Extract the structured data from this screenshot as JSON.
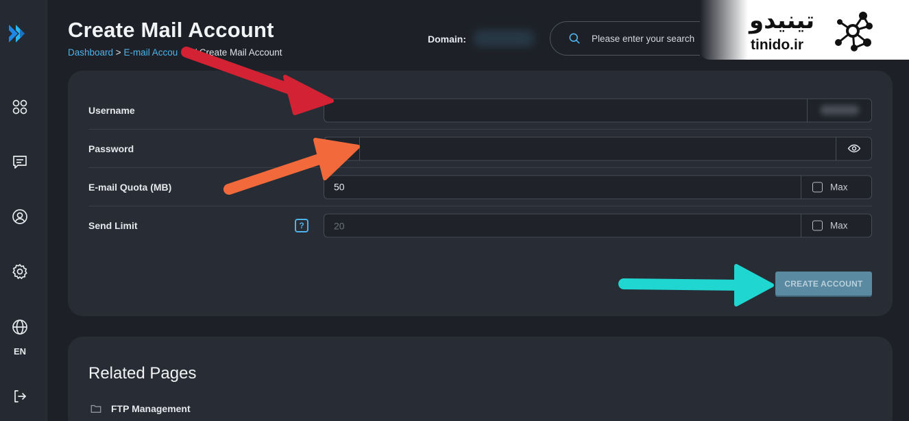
{
  "sidebar": {
    "language": "EN",
    "items": [
      {
        "icon": "grid-icon"
      },
      {
        "icon": "message-icon"
      },
      {
        "icon": "user-circle-icon"
      },
      {
        "icon": "settings-icon"
      },
      {
        "icon": "globe-icon"
      },
      {
        "icon": "logout-icon"
      }
    ]
  },
  "header": {
    "title": "Create Mail Account",
    "breadcrumb": {
      "dashboard": "Dashboard",
      "separator1": " > ",
      "email_accounts": "E-mail Accou",
      "current": "/ Create Mail Account"
    },
    "domain_label": "Domain:",
    "search_placeholder": "Please enter your search"
  },
  "watermark": {
    "persian_text": "تینیدو",
    "site": "tinido.ir"
  },
  "form": {
    "username": {
      "label": "Username",
      "value": ""
    },
    "password": {
      "label": "Password",
      "value": ""
    },
    "quota": {
      "label": "E-mail Quota (MB)",
      "value": "50",
      "max_label": "Max"
    },
    "send_limit": {
      "label": "Send Limit",
      "placeholder": "20",
      "help": "?",
      "max_label": "Max"
    },
    "submit_label": "CREATE ACCOUNT"
  },
  "related": {
    "title": "Related Pages",
    "items": [
      {
        "label": "FTP Management"
      }
    ]
  },
  "colors": {
    "accent": "#4fb3ea",
    "arrow_red": "#d32233",
    "arrow_orange": "#f26a3b",
    "arrow_cyan": "#1fd6d0",
    "button": "#5a8aa1"
  }
}
